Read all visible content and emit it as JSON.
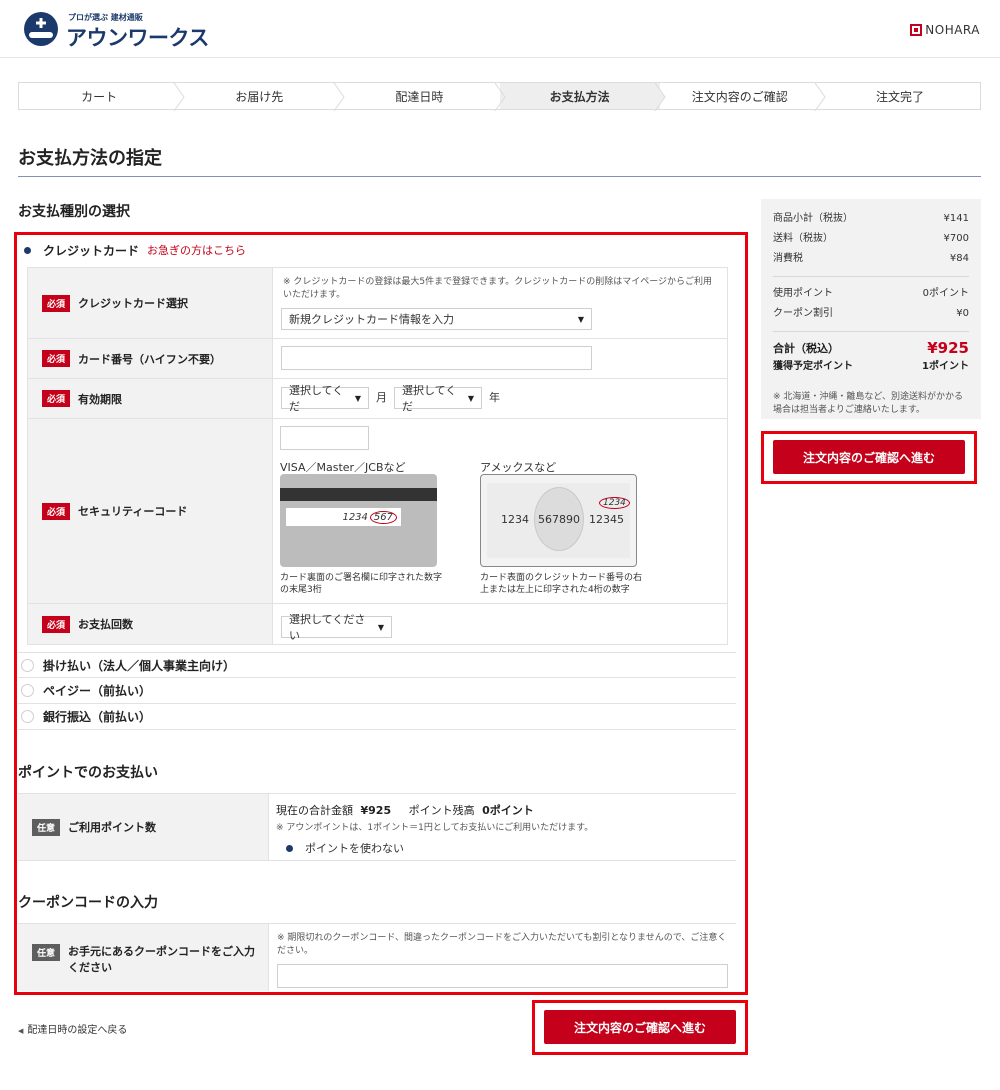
{
  "header": {
    "logo_tagline": "プロが選ぶ 建材通販",
    "logo_name": "アウンワークス",
    "partner_name": "NOHARA"
  },
  "steps": [
    {
      "label": "カート",
      "active": false
    },
    {
      "label": "お届け先",
      "active": false
    },
    {
      "label": "配達日時",
      "active": false
    },
    {
      "label": "お支払方法",
      "active": true
    },
    {
      "label": "注文内容のご確認",
      "active": false
    },
    {
      "label": "注文完了",
      "active": false
    }
  ],
  "page_title": "お支払方法の指定",
  "payment": {
    "section_title": "お支払種別の選択",
    "credit_card": {
      "label": "クレジットカード",
      "urgent_link": "お急ぎの方はこちら",
      "selected": true,
      "required_badge": "必須",
      "card_select": {
        "label": "クレジットカード選択",
        "note": "※ クレジットカードの登録は最大5件まで登録できます。クレジットカードの削除はマイページからご利用いただけます。",
        "value": "新規クレジットカード情報を入力"
      },
      "card_number": {
        "label": "カード番号（ハイフン不要）",
        "value": ""
      },
      "expiry": {
        "label": "有効期限",
        "month_value": "選択してくだ",
        "month_unit": "月",
        "year_value": "選択してくだ",
        "year_unit": "年"
      },
      "security_code": {
        "label": "セキュリティーコード",
        "value": "",
        "visa_title": "VISA／Master／JCBなど",
        "visa_digits": "1234",
        "visa_code": "567",
        "visa_caption_1": "カード裏面のご署名欄に印字された数字",
        "visa_caption_2": "の末尾3桁",
        "amex_title": "アメックスなど",
        "amex_num_1": "1234",
        "amex_num_2": "567890",
        "amex_num_3": "12345",
        "amex_code": "1234",
        "amex_caption_1": "カード表面のクレジットカード番号の右",
        "amex_caption_2": "上または左上に印字された4桁の数字"
      },
      "installments": {
        "label": "お支払回数",
        "value": "選択してください"
      }
    },
    "other_methods": [
      {
        "label": "掛け払い（法人／個人事業主向け）"
      },
      {
        "label": "ペイジー（前払い）"
      },
      {
        "label": "銀行振込（前払い）"
      }
    ]
  },
  "points": {
    "section_title": "ポイントでのお支払い",
    "badge": "任意",
    "label": "ご利用ポイント数",
    "total_label": "現在の合計金額",
    "total_value": "¥925",
    "balance_label": "ポイント残高",
    "balance_value": "0ポイント",
    "note": "※ アウンポイントは、1ポイント＝1円としてお支払いにご利用いただけます。",
    "option": "ポイントを使わない"
  },
  "coupon": {
    "section_title": "クーポンコードの入力",
    "badge": "任意",
    "label_1": "お手元にあるクーポンコードをご入力",
    "label_2": "ください",
    "note": "※ 期限切れのクーポンコード、間違ったクーポンコードをご入力いただいても割引となりませんので、ご注意ください。",
    "value": ""
  },
  "summary": {
    "subtotal_label": "商品小計（税抜）",
    "subtotal_value": "¥141",
    "shipping_label": "送料（税抜）",
    "shipping_value": "¥700",
    "tax_label": "消費税",
    "tax_value": "¥84",
    "used_points_label": "使用ポイント",
    "used_points_value": "0ポイント",
    "coupon_label": "クーポン割引",
    "coupon_value": "¥0",
    "total_label": "合計（税込）",
    "total_value": "¥925",
    "earn_label": "獲得予定ポイント",
    "earn_value": "1ポイント",
    "note": "※ 北海道・沖縄・離島など、別途送料がかかる場合は担当者よりご連絡いたします。"
  },
  "actions": {
    "confirm_label": "注文内容のご確認へ進む",
    "back_label": "配達日時の設定へ戻る"
  },
  "colors": {
    "accent": "#c4001a",
    "brand": "#1b3a6b",
    "highlight": "#e8000d"
  }
}
